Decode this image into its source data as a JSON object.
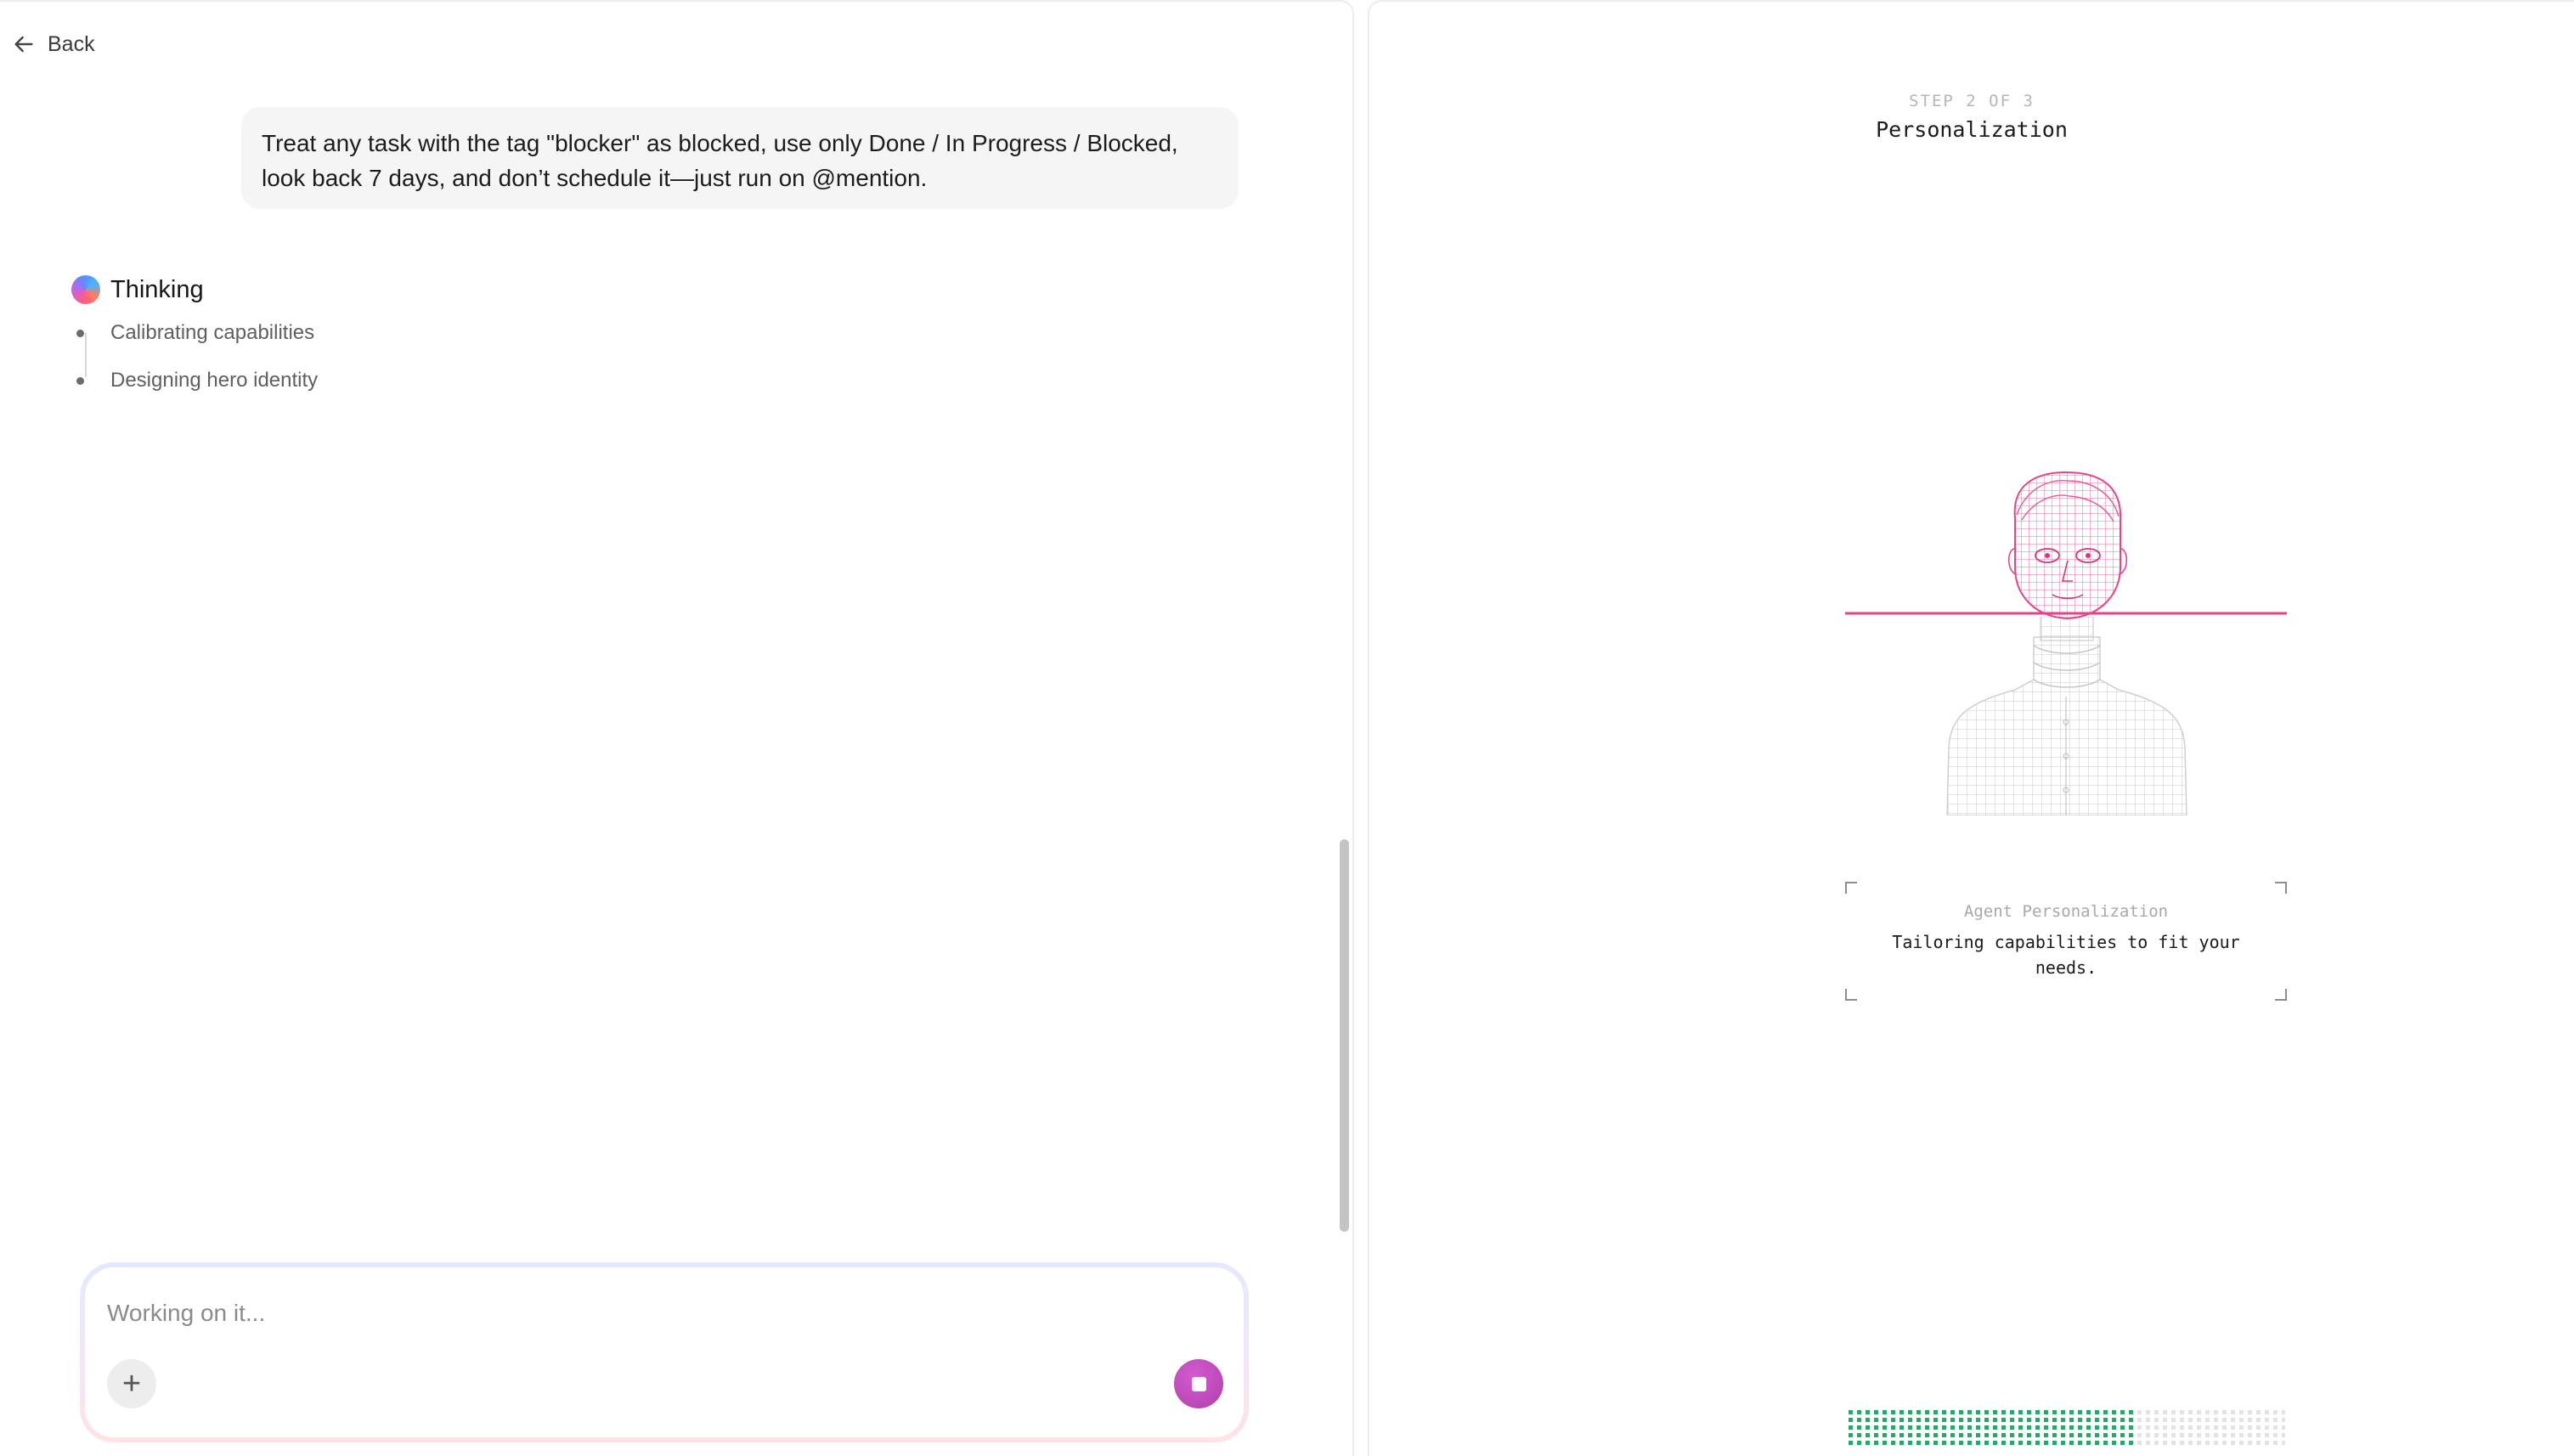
{
  "nav": {
    "back_label": "Back"
  },
  "chat": {
    "user_message": "Treat any task with the tag \"blocker\" as blocked, use only Done / In Progress / Blocked, look back 7 days, and don’t schedule it—just run on @mention.",
    "thinking": {
      "label": "Thinking",
      "steps": [
        "Calibrating capabilities",
        "Designing hero identity"
      ]
    }
  },
  "composer": {
    "placeholder": "Working on it...",
    "add_icon": "plus-icon",
    "stop_icon": "stop-icon"
  },
  "onboarding": {
    "step_indicator": "STEP 2 OF 3",
    "title": "Personalization",
    "card": {
      "heading": "Agent Personalization",
      "text": "Tailoring capabilities to fit your needs."
    },
    "progress": {
      "fraction": 0.65
    }
  },
  "colors": {
    "accent_pink": "#e8438a",
    "progress_green": "#2ea36b",
    "stop_button": "#c24bbd"
  }
}
